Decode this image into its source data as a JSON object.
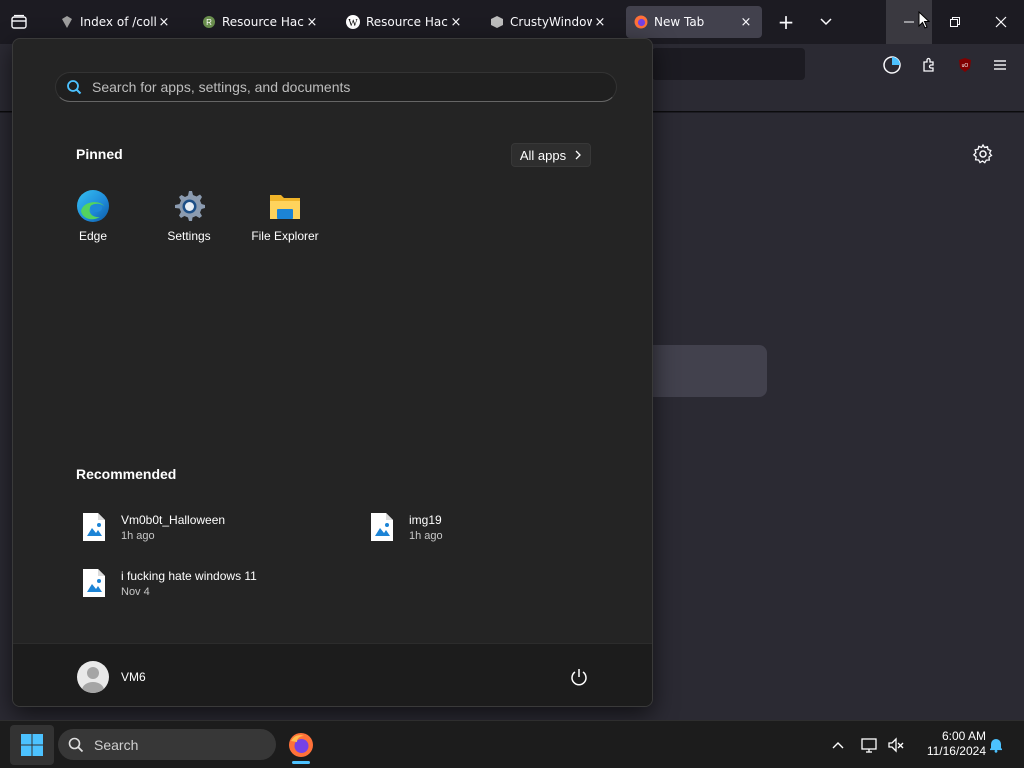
{
  "browser": {
    "tabs": [
      {
        "title": "Index of /collect",
        "icon": "page-icon",
        "active": false
      },
      {
        "title": "Resource Hacke",
        "icon": "resource-hacker-icon",
        "active": false
      },
      {
        "title": "Resource Hacke",
        "icon": "wikipedia-icon",
        "active": false
      },
      {
        "title": "CrustyWindows",
        "icon": "crustywindows-icon",
        "active": false
      },
      {
        "title": "New Tab",
        "icon": "firefox-icon",
        "active": true
      }
    ],
    "new_tab_label": "+",
    "close_glyph": "×"
  },
  "start_menu": {
    "search_placeholder": "Search for apps, settings, and documents",
    "pinned_title": "Pinned",
    "all_apps_label": "All apps",
    "pinned": [
      {
        "label": "Edge",
        "icon": "edge-icon"
      },
      {
        "label": "Settings",
        "icon": "settings-gear-icon"
      },
      {
        "label": "File Explorer",
        "icon": "folder-icon"
      }
    ],
    "recommended_title": "Recommended",
    "recommended": [
      {
        "name": "Vm0b0t_Halloween",
        "time": "1h ago"
      },
      {
        "name": "img19",
        "time": "1h ago"
      },
      {
        "name": "i fucking hate windows 11",
        "time": "Nov 4"
      }
    ],
    "user_name": "VM6"
  },
  "taskbar": {
    "search_label": "Search",
    "time": "6:00 AM",
    "date": "11/16/2024"
  },
  "colors": {
    "accent": "#4cc2ff",
    "start_bg": "#242424",
    "taskbar_bg": "#1c1c1c"
  }
}
